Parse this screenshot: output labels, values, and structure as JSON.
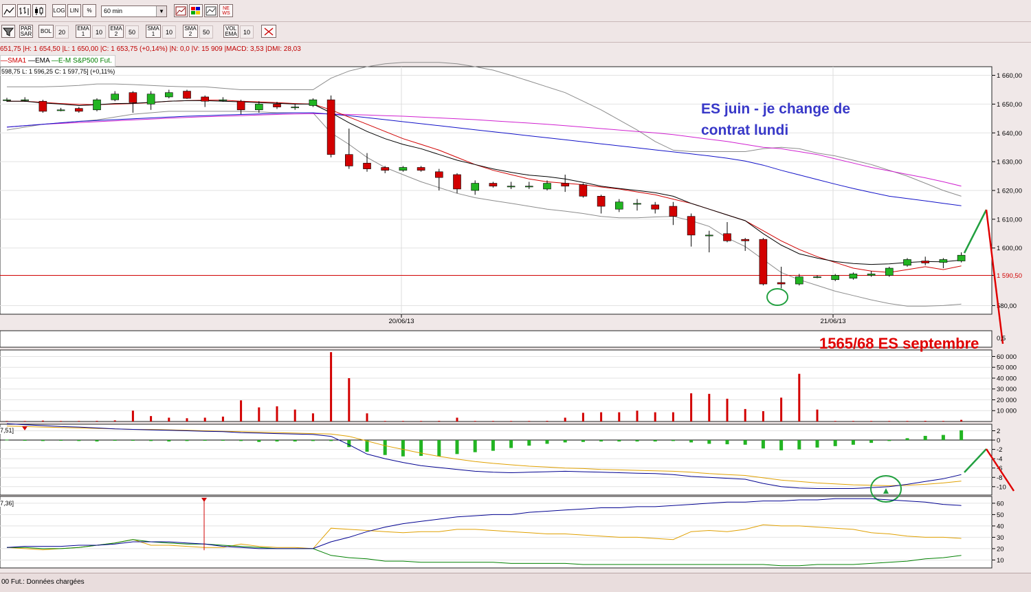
{
  "toolbar1": {
    "buttons": [
      "LOG",
      "LIN",
      "%"
    ],
    "timeframe": "60 min",
    "icon_names": [
      "line-chart-icon",
      "bar-chart-icon",
      "candlestick-icon",
      "chart-settings-icon",
      "color-palette-icon",
      "compare-chart-icon",
      "news-icon"
    ],
    "news_label": "NE WS"
  },
  "toolbar2": {
    "items": [
      {
        "label": "PAR SAR",
        "value": ""
      },
      {
        "label": "BOL",
        "value": "20"
      },
      {
        "label": "EMA 1",
        "value": "10"
      },
      {
        "label": "EMA 2",
        "value": "50"
      },
      {
        "label": "SMA 1",
        "value": "10"
      },
      {
        "label": "SMA 2",
        "value": "50"
      },
      {
        "label": "VOL EMA",
        "value": "10"
      }
    ]
  },
  "infobar": "651,75 |H: 1 654,50 |L: 1 650,00 |C: 1 653,75 (+0,14%) |N: 0,0 |V: 15 909 |MACD: 3,53 |DMI: 28,03",
  "legend": {
    "items": [
      {
        "name": "SMA1",
        "color": "#d00000"
      },
      {
        "name": "EMA",
        "color": "#000000"
      },
      {
        "name": "E-M S&P500 Fut.",
        "color": "#008000"
      }
    ]
  },
  "ohlc_text": "598,75  L: 1 596,25  C: 1 597,75] (+0,11%)",
  "annotations": {
    "blue_line1": "ES juin - je change de",
    "blue_line2": "contrat lundi",
    "red_target": "1565/68 ES septembre"
  },
  "status_text": "00 Fut.: Données chargées",
  "sublabels": {
    "macd": "7,51]",
    "dmi": "7,36]",
    "volume_axis_top": "0,5"
  },
  "colors": {
    "bull": "#22b422",
    "bear": "#d20000",
    "sma": "#d00000",
    "ema": "#000000",
    "bollinger": "#8c8c8c",
    "ma_blue": "#1010c8",
    "ma_magenta": "#d020d0",
    "support": "#d00000",
    "macd_line": "#000090",
    "signal_line": "#e0a000",
    "dmi_plus": "#e0a000",
    "dmi_minus": "#008000",
    "adx": "#000090",
    "annotation_blue": "#3838c8"
  },
  "chart_data": [
    {
      "type": "candlestick",
      "title": "",
      "x_labels": [
        "20/06/13",
        "21/06/13"
      ],
      "y_ticks": [
        1580,
        1590.5,
        1600,
        1610,
        1620,
        1630,
        1640,
        1650,
        1660
      ],
      "y_tick_labels": [
        "580,00",
        "1 590,50",
        "1 600,00",
        "1 610,00",
        "1 620,00",
        "1 630,00",
        "1 640,00",
        "1 650,00",
        "1 660,00"
      ],
      "ylim": [
        1577,
        1663
      ],
      "support_level": 1590.5,
      "candles": [
        [
          1651.5,
          1651.5,
          1652.2,
          1650.8
        ],
        [
          1651.5,
          1651.5,
          1652.4,
          1650.8
        ],
        [
          1651,
          1647.5,
          1651.5,
          1647
        ],
        [
          1648,
          1648,
          1648.7,
          1647.5
        ],
        [
          1648.5,
          1647.5,
          1649,
          1647
        ],
        [
          1648,
          1651.5,
          1652,
          1647.5
        ],
        [
          1651.5,
          1653.5,
          1654.5,
          1651
        ],
        [
          1654,
          1650.5,
          1654.5,
          1647
        ],
        [
          1650,
          1653.5,
          1654.5,
          1648
        ],
        [
          1652.5,
          1654,
          1655,
          1652
        ],
        [
          1654.5,
          1652,
          1655,
          1651.8
        ],
        [
          1652.5,
          1651,
          1653,
          1649
        ],
        [
          1651.5,
          1651.5,
          1652.4,
          1650.8
        ],
        [
          1651,
          1648,
          1651.5,
          1646.5
        ],
        [
          1648,
          1650,
          1651,
          1647
        ],
        [
          1650,
          1649,
          1650.8,
          1648.3
        ],
        [
          1649,
          1649,
          1650,
          1648
        ],
        [
          1649.5,
          1651.5,
          1652,
          1649
        ],
        [
          1651.5,
          1632.5,
          1653,
          1631.5
        ],
        [
          1632.5,
          1628.5,
          1641.5,
          1627.5
        ],
        [
          1629.5,
          1627.5,
          1633,
          1626.5
        ],
        [
          1628,
          1627,
          1628.5,
          1626
        ],
        [
          1627,
          1628,
          1628.5,
          1626.5
        ],
        [
          1628,
          1627,
          1628.5,
          1626.5
        ],
        [
          1626.5,
          1624.5,
          1627.5,
          1620
        ],
        [
          1625.5,
          1620.5,
          1626,
          1619
        ],
        [
          1620,
          1622.5,
          1623.5,
          1618.5
        ],
        [
          1622.5,
          1621.5,
          1623,
          1621
        ],
        [
          1621.5,
          1621.5,
          1623,
          1620.5
        ],
        [
          1621.5,
          1621.5,
          1623,
          1620.5
        ],
        [
          1620.5,
          1622.5,
          1623.5,
          1620
        ],
        [
          1622.5,
          1621.5,
          1625.5,
          1619.5
        ],
        [
          1622,
          1618,
          1622.5,
          1617.5
        ],
        [
          1618,
          1614.5,
          1618.5,
          1612
        ],
        [
          1613.5,
          1616,
          1617,
          1612.5
        ],
        [
          1615.5,
          1615.5,
          1617,
          1613
        ],
        [
          1615,
          1613.5,
          1616,
          1612
        ],
        [
          1614.5,
          1611,
          1616,
          1608
        ],
        [
          1611,
          1604.5,
          1612,
          1600.5
        ],
        [
          1604.5,
          1604.5,
          1606,
          1598.5
        ],
        [
          1605,
          1602.5,
          1609,
          1602
        ],
        [
          1603,
          1602.5,
          1603.5,
          1599
        ],
        [
          1603,
          1587.5,
          1603.5,
          1587
        ],
        [
          1588,
          1587.5,
          1593.5,
          1586
        ],
        [
          1587.5,
          1590,
          1591,
          1587
        ],
        [
          1590,
          1590,
          1590.5,
          1589.5
        ],
        [
          1589,
          1590.5,
          1591,
          1588.5
        ],
        [
          1589.5,
          1591,
          1591.5,
          1589
        ],
        [
          1590.5,
          1591,
          1592,
          1590
        ],
        [
          1590.5,
          1593,
          1593.5,
          1590
        ],
        [
          1594,
          1596,
          1596.5,
          1593.5
        ],
        [
          1595.5,
          1594.8,
          1597,
          1594
        ],
        [
          1595,
          1596,
          1596.5,
          1593
        ],
        [
          1595.5,
          1597.5,
          1598.5,
          1595
        ]
      ],
      "sma": [
        1651,
        1651,
        1650.6,
        1650.2,
        1649.9,
        1649.8,
        1650,
        1650.2,
        1650.5,
        1651,
        1651.2,
        1651.4,
        1651.4,
        1651,
        1650.8,
        1650.5,
        1650.2,
        1650,
        1648,
        1645.5,
        1643,
        1640.5,
        1638,
        1636,
        1634,
        1631.5,
        1629,
        1627,
        1625.5,
        1624,
        1623,
        1622.5,
        1622,
        1621.2,
        1620.5,
        1619.5,
        1618.5,
        1617,
        1615.5,
        1613.5,
        1611.5,
        1609.5,
        1606,
        1602.5,
        1599.5,
        1597,
        1595,
        1593,
        1592,
        1591.5,
        1592.5,
        1593.5,
        1592.5,
        1593.8
      ],
      "ema": [
        1651,
        1651,
        1650.4,
        1650,
        1649.5,
        1649.8,
        1650.2,
        1650.3,
        1650.6,
        1651,
        1651.2,
        1651.2,
        1651,
        1650.8,
        1650.5,
        1650.3,
        1650,
        1650,
        1647,
        1643.5,
        1640.5,
        1638,
        1636,
        1634.5,
        1632.5,
        1630.5,
        1629,
        1627.5,
        1626.3,
        1625.3,
        1624.8,
        1624,
        1622.8,
        1621.5,
        1620.7,
        1620,
        1619.2,
        1618,
        1615.5,
        1613.5,
        1611.5,
        1609.5,
        1605,
        1601,
        1598,
        1596.5,
        1595.3,
        1594.6,
        1594.3,
        1594.5,
        1595,
        1595.3,
        1595.2,
        1595.8
      ],
      "bb_upper": [
        1656,
        1656,
        1656,
        1656.2,
        1656.5,
        1657,
        1657,
        1656.8,
        1656.5,
        1656.2,
        1656,
        1656,
        1655.5,
        1655,
        1655,
        1655,
        1655,
        1655,
        1659,
        1661.5,
        1663,
        1664,
        1664.5,
        1664.5,
        1664.5,
        1664,
        1663,
        1661.8,
        1660,
        1658,
        1656,
        1654,
        1651,
        1648,
        1644.5,
        1641,
        1637,
        1634,
        1633.5,
        1633.5,
        1633.5,
        1633.5,
        1634.5,
        1635,
        1634.5,
        1633,
        1632,
        1630.5,
        1629,
        1627,
        1625,
        1622.5,
        1620,
        1618
      ],
      "bb_lower": [
        1641,
        1642,
        1643,
        1643.5,
        1644,
        1644.5,
        1645.5,
        1646.5,
        1647,
        1647.5,
        1647.5,
        1647.5,
        1647.5,
        1647.5,
        1647.3,
        1647,
        1647,
        1647,
        1640,
        1636,
        1631.5,
        1628,
        1625.5,
        1623,
        1621,
        1619,
        1617.5,
        1616.5,
        1615.5,
        1614.5,
        1613.5,
        1612.8,
        1612,
        1611,
        1610.5,
        1610.5,
        1610.8,
        1611,
        1609.5,
        1607.5,
        1603.5,
        1600.5,
        1596,
        1591.5,
        1589,
        1587,
        1585,
        1583.5,
        1582,
        1580.7,
        1579.8,
        1579.8,
        1580,
        1580.5
      ],
      "ma_blue": [
        1642,
        1642.5,
        1643,
        1643.5,
        1644,
        1644.3,
        1644.6,
        1644.9,
        1645.2,
        1645.5,
        1645.8,
        1646,
        1646.2,
        1646.4,
        1646.6,
        1646.8,
        1647,
        1647,
        1646.5,
        1646,
        1645.3,
        1644.6,
        1643.9,
        1643.2,
        1642.5,
        1641.8,
        1641.1,
        1640.4,
        1639.7,
        1639,
        1638.3,
        1637.6,
        1636.9,
        1636.2,
        1635.5,
        1634.8,
        1634.1,
        1633.4,
        1632.7,
        1632,
        1631.2,
        1630.2,
        1628.8,
        1627,
        1625.4,
        1623.8,
        1622.2,
        1620.7,
        1619.3,
        1618,
        1617.2,
        1616.4,
        1615.5,
        1614.7
      ],
      "ma_magenta": [
        1642,
        1642.5,
        1643,
        1643.3,
        1643.6,
        1643.9,
        1644.2,
        1644.5,
        1644.8,
        1645.1,
        1645.4,
        1645.6,
        1645.8,
        1646,
        1646.2,
        1646.4,
        1646.6,
        1646.7,
        1646.6,
        1646.4,
        1646.2,
        1646,
        1645.8,
        1645.5,
        1645.2,
        1644.9,
        1644.6,
        1644.2,
        1643.8,
        1643.4,
        1643,
        1642.5,
        1642,
        1641.5,
        1641,
        1640.5,
        1640,
        1639.4,
        1638.6,
        1637.8,
        1637,
        1636,
        1635,
        1634.5,
        1633.5,
        1632.5,
        1631,
        1629.5,
        1628,
        1626.8,
        1625.6,
        1624.4,
        1623,
        1621.5
      ]
    },
    {
      "type": "bar",
      "title": "",
      "y_ticks": [
        10000,
        20000,
        30000,
        40000,
        50000,
        60000
      ],
      "y_tick_labels": [
        "10 000",
        "20 000",
        "30 000",
        "40 000",
        "50 000",
        "60 000"
      ],
      "ylim": [
        0,
        66000
      ],
      "values": [
        500,
        500,
        800,
        500,
        500,
        600,
        1000,
        10000,
        5000,
        3500,
        3000,
        3500,
        4500,
        19500,
        13000,
        14000,
        11000,
        7500,
        64000,
        40000,
        7500,
        500,
        500,
        500,
        600,
        3500,
        500,
        500,
        500,
        500,
        600,
        3500,
        8000,
        8500,
        8500,
        10000,
        8500,
        8500,
        26000,
        25500,
        21000,
        11500,
        9500,
        22000,
        44000,
        11000,
        500,
        500,
        500,
        500,
        500,
        600,
        500,
        1500
      ]
    },
    {
      "type": "line",
      "title": "",
      "y_ticks": [
        2,
        0,
        -2,
        -4,
        -6,
        -8,
        -10
      ],
      "y_tick_labels": [
        "2",
        "0",
        "-2",
        "-4",
        "-6",
        "-8",
        "-10"
      ],
      "ylim": [
        -11.8,
        3.4
      ],
      "histogram": [
        0.1,
        -0.1,
        -0.2,
        -0.1,
        -0.2,
        -0.3,
        -0.1,
        -0.1,
        -0.2,
        -0.3,
        -0.2,
        -0.1,
        -0.1,
        -0.2,
        -0.4,
        -0.3,
        -0.3,
        -0.2,
        -0.2,
        -1.5,
        -2.5,
        -3.2,
        -3.5,
        -3.4,
        -3.5,
        -3.0,
        -2.6,
        -2.3,
        -1.7,
        -1.2,
        -0.8,
        -0.5,
        -0.4,
        -0.3,
        -0.3,
        -0.3,
        -0.3,
        -0.2,
        -0.5,
        -0.8,
        -0.9,
        -1.0,
        -1.8,
        -2.2,
        -2.0,
        -1.6,
        -1.3,
        -1.0,
        -0.6,
        -0.2,
        0.4,
        0.9,
        1.1,
        2.1
      ],
      "macd": [
        3.5,
        3.3,
        3.1,
        2.9,
        2.8,
        2.6,
        2.4,
        2.3,
        2.2,
        2.1,
        2.0,
        1.9,
        1.8,
        1.6,
        1.5,
        1.4,
        1.3,
        1.2,
        0.8,
        -1.0,
        -3.0,
        -4.0,
        -4.8,
        -5.5,
        -5.9,
        -6.3,
        -6.7,
        -6.9,
        -7.0,
        -6.9,
        -6.8,
        -6.7,
        -6.8,
        -6.9,
        -7.0,
        -7.1,
        -7.2,
        -7.4,
        -7.8,
        -8.0,
        -8.2,
        -8.4,
        -9.3,
        -10.0,
        -10.3,
        -10.4,
        -10.4,
        -10.4,
        -10.2,
        -10.0,
        -9.5,
        -8.9,
        -8.3,
        -7.4
      ],
      "signal": [
        3.0,
        2.9,
        2.8,
        2.7,
        2.6,
        2.5,
        2.4,
        2.3,
        2.3,
        2.2,
        2.1,
        2.0,
        1.9,
        1.8,
        1.7,
        1.6,
        1.5,
        1.4,
        1.3,
        0.8,
        -0.2,
        -1.2,
        -2.0,
        -2.8,
        -3.5,
        -4.1,
        -4.6,
        -5.0,
        -5.3,
        -5.6,
        -5.8,
        -6.0,
        -6.1,
        -6.3,
        -6.4,
        -6.5,
        -6.6,
        -6.7,
        -6.9,
        -7.2,
        -7.4,
        -7.6,
        -8.1,
        -8.6,
        -8.9,
        -9.2,
        -9.4,
        -9.6,
        -9.7,
        -9.8,
        -9.7,
        -9.5,
        -9.2,
        -8.8
      ]
    },
    {
      "type": "line",
      "title": "",
      "y_ticks": [
        10,
        20,
        30,
        40,
        50,
        60
      ],
      "y_tick_labels": [
        "10",
        "20",
        "30",
        "40",
        "50",
        "60"
      ],
      "ylim": [
        3,
        66
      ],
      "dmi_plus": [
        21,
        20,
        19,
        20,
        21,
        23,
        25,
        28,
        23,
        23,
        22,
        21,
        21,
        24,
        22,
        21,
        21,
        20,
        38,
        37,
        36,
        35,
        34,
        35,
        35,
        37,
        37,
        36,
        35,
        34,
        33,
        33,
        32,
        31,
        30,
        30,
        29,
        28,
        35,
        36,
        35,
        37,
        41,
        40,
        40,
        39,
        38,
        37,
        34,
        33,
        31,
        30,
        30,
        29
      ],
      "dmi_minus": [
        21,
        21,
        20,
        20,
        21,
        23,
        25,
        28,
        26,
        25,
        24,
        24,
        23,
        22,
        21,
        20,
        20,
        20,
        14,
        12,
        11,
        9,
        9,
        8,
        8,
        8,
        8,
        8,
        7,
        7,
        7,
        7,
        6,
        6,
        6,
        6,
        6,
        6,
        6,
        6,
        6,
        6,
        6,
        5,
        5,
        6,
        6,
        6,
        7,
        8,
        9,
        11,
        12,
        14
      ],
      "adx": [
        21,
        22,
        22,
        22,
        23,
        23,
        24,
        26,
        26,
        26,
        25,
        24,
        22,
        21,
        20,
        20,
        20,
        20,
        26,
        30,
        35,
        39,
        42,
        44,
        46,
        48,
        49,
        50,
        50,
        52,
        53,
        54,
        55,
        56,
        56,
        57,
        57,
        58,
        59,
        60,
        61,
        61,
        62,
        62,
        63,
        63,
        64,
        64,
        64,
        63,
        62,
        61,
        59,
        58
      ]
    }
  ],
  "bottom_labels": {
    "x": "",
    "y": ""
  }
}
